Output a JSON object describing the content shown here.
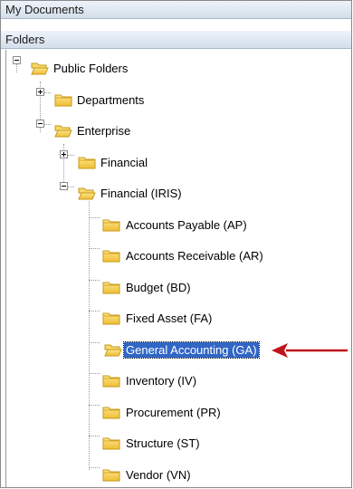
{
  "panels": {
    "my_documents": "My Documents",
    "folders": "Folders"
  },
  "tree": {
    "root": "Public Folders",
    "departments": "Departments",
    "enterprise": "Enterprise",
    "financial": "Financial",
    "financial_iris": "Financial (IRIS)",
    "children": [
      "Accounts Payable (AP)",
      "Accounts Receivable (AR)",
      "Budget (BD)",
      "Fixed Asset (FA)",
      "General Accounting (GA)",
      "Inventory (IV)",
      "Procurement (PR)",
      "Structure (ST)",
      "Vendor (VN)"
    ],
    "selected": "General Accounting (GA)"
  },
  "colors": {
    "selection": "#3166c5",
    "annotation_arrow": "#c0141c",
    "folder": "#f3c845"
  }
}
